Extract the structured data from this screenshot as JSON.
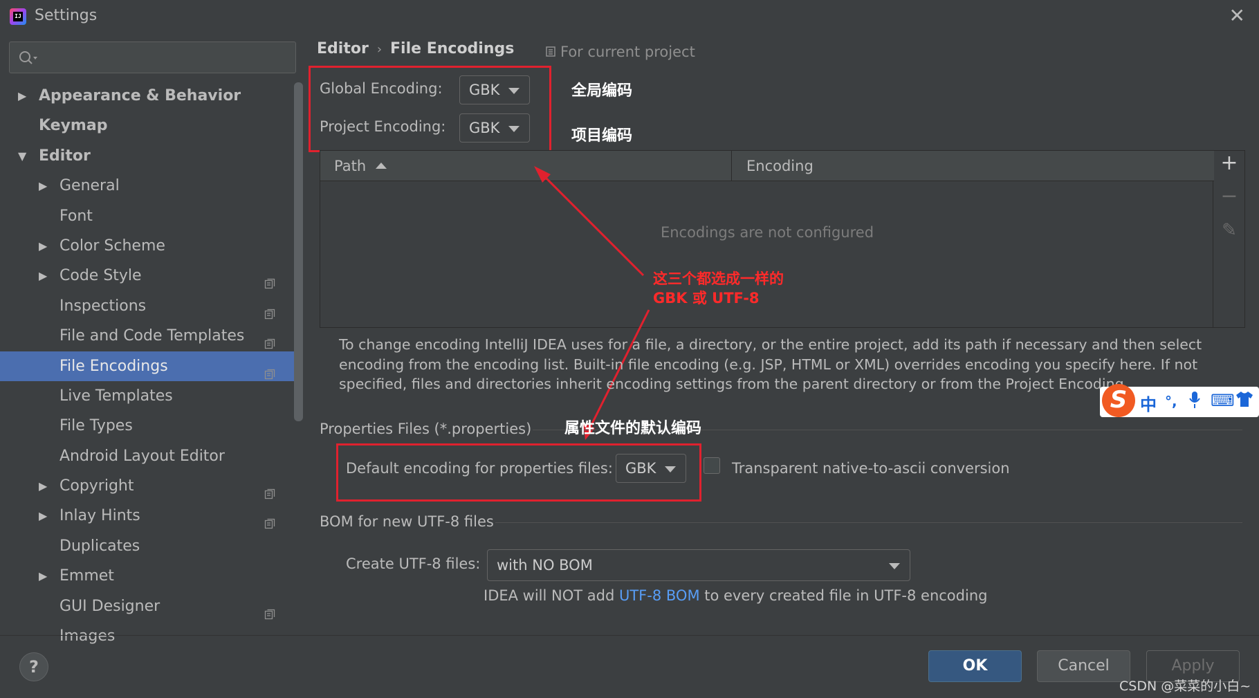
{
  "window": {
    "title": "Settings",
    "app_icon_text": "IJ"
  },
  "sidebar": {
    "search_placeholder": "",
    "items": [
      {
        "label": "Appearance & Behavior",
        "level": 0,
        "arrow": "▶",
        "project": false
      },
      {
        "label": "Keymap",
        "level": 0,
        "arrow": "",
        "project": false
      },
      {
        "label": "Editor",
        "level": 0,
        "arrow": "▼",
        "project": false
      },
      {
        "label": "General",
        "level": 1,
        "arrow": "▶",
        "project": false
      },
      {
        "label": "Font",
        "level": 1,
        "arrow": "",
        "project": false
      },
      {
        "label": "Color Scheme",
        "level": 1,
        "arrow": "▶",
        "project": false
      },
      {
        "label": "Code Style",
        "level": 1,
        "arrow": "▶",
        "project": true
      },
      {
        "label": "Inspections",
        "level": 1,
        "arrow": "",
        "project": true
      },
      {
        "label": "File and Code Templates",
        "level": 1,
        "arrow": "",
        "project": true
      },
      {
        "label": "File Encodings",
        "level": 1,
        "arrow": "",
        "project": true,
        "selected": true
      },
      {
        "label": "Live Templates",
        "level": 1,
        "arrow": "",
        "project": false
      },
      {
        "label": "File Types",
        "level": 1,
        "arrow": "",
        "project": false
      },
      {
        "label": "Android Layout Editor",
        "level": 1,
        "arrow": "",
        "project": false
      },
      {
        "label": "Copyright",
        "level": 1,
        "arrow": "▶",
        "project": true
      },
      {
        "label": "Inlay Hints",
        "level": 1,
        "arrow": "▶",
        "project": true
      },
      {
        "label": "Duplicates",
        "level": 1,
        "arrow": "",
        "project": false
      },
      {
        "label": "Emmet",
        "level": 1,
        "arrow": "▶",
        "project": false
      },
      {
        "label": "GUI Designer",
        "level": 1,
        "arrow": "",
        "project": true
      },
      {
        "label": "Images",
        "level": 1,
        "arrow": "",
        "project": false
      }
    ]
  },
  "breadcrumb": {
    "parent": "Editor",
    "current": "File Encodings",
    "separator": "›"
  },
  "for_project": "For current project",
  "global_encoding": {
    "label": "Global Encoding:",
    "value": "GBK"
  },
  "project_encoding": {
    "label": "Project Encoding:",
    "value": "GBK"
  },
  "table": {
    "col_path": "Path",
    "col_encoding": "Encoding",
    "empty_text": "Encodings are not configured",
    "add": "+",
    "remove": "−",
    "edit": "✎"
  },
  "description": "To change encoding IntelliJ IDEA uses for a file, a directory, or the entire project, add its path if necessary and then select encoding from the encoding list. Built-in file encoding (e.g. JSP, HTML or XML) overrides encoding you specify here. If not specified, files and directories inherit encoding settings from the parent directory or from the Project Encoding.",
  "properties": {
    "section_title": "Properties Files (*.properties)",
    "default_label": "Default encoding for properties files:",
    "default_value": "GBK",
    "native_ascii_label": "Transparent native-to-ascii conversion"
  },
  "bom": {
    "section_title": "BOM for new UTF-8 files",
    "create_label": "Create UTF-8 files:",
    "create_value": "with NO BOM",
    "hint_before": "IDEA will NOT add ",
    "hint_link": "UTF-8 BOM",
    "hint_after": " to every created file in UTF-8 encoding"
  },
  "annotations": {
    "global_cn": "全局编码",
    "project_cn": "项目编码",
    "same_line1": "这三个都选成一样的",
    "same_line2": "GBK 或 UTF-8",
    "properties_cn": "属性文件的默认编码"
  },
  "buttons": {
    "help": "?",
    "ok": "OK",
    "cancel": "Cancel",
    "apply": "Apply"
  },
  "ime": {
    "logo": "S",
    "chinese": "中",
    "punct": "°,",
    "keyboard": "⌨",
    "skin": "👕"
  },
  "watermark": "CSDN @菜菜的小白~",
  "colors": {
    "selection": "#4b6eaf",
    "annotation_red": "#e0212e",
    "link": "#589df6",
    "ok_button": "#365880"
  }
}
